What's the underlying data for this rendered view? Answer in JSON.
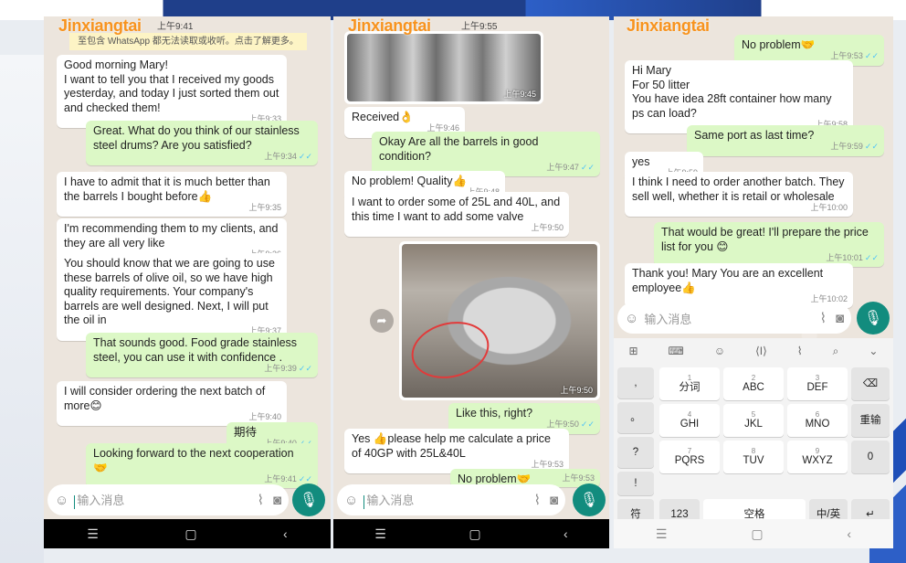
{
  "watermark": "Jinxiangtai",
  "phone1": {
    "status_time": "上午9:41",
    "notice": "至包含 WhatsApp 都无法读取或收听。点击了解更多。",
    "messages": [
      {
        "text": "Good morning  Mary!\nI want to tell you that I received my goods yesterday, and today I just sorted them out and checked them!",
        "time": "上午9:33",
        "dir": "in"
      },
      {
        "text": "Great. What do you think of our stainless steel drums? Are you satisfied?",
        "time": "上午9:34",
        "dir": "out"
      },
      {
        "text": "I have to admit that it is much better than the barrels I bought before👍",
        "time": "上午9:35",
        "dir": "in"
      },
      {
        "text": "I'm recommending them to my clients, and they are all very like",
        "time": "上午9:36",
        "dir": "in"
      },
      {
        "text": "You should know that we are going to use these barrels of olive oil, so we have high quality requirements. Your company's barrels are well designed. Next, I will put the oil in",
        "time": "上午9:37",
        "dir": "in"
      },
      {
        "text": "That sounds good. Food grade stainless steel, you can use it with confidence .",
        "time": "上午9:39",
        "dir": "out"
      },
      {
        "text": "I will consider ordering the next batch of more😊",
        "time": "上午9:40",
        "dir": "in"
      },
      {
        "text": "期待",
        "time": "上午9:40",
        "dir": "out"
      },
      {
        "text": "Looking forward to the next cooperation 🤝",
        "time": "上午9:41",
        "dir": "out"
      }
    ],
    "input_placeholder": "输入消息"
  },
  "phone2": {
    "status_time": "上午9:55",
    "photo1_time": "上午9:45",
    "messages": [
      {
        "text": "Received👌",
        "time": "上午9:46",
        "dir": "in"
      },
      {
        "text": "Okay  Are all the barrels in good condition?",
        "time": "上午9:47",
        "dir": "out"
      },
      {
        "text": "No problem! Quality👍",
        "time": "上午9:48",
        "dir": "in"
      },
      {
        "text": "I want to order some of 25L and 40L, and this time I want to add some valve",
        "time": "上午9:50",
        "dir": "in"
      },
      {
        "text": "Like this, right?",
        "time": "上午9:50",
        "dir": "out"
      },
      {
        "text": "Yes 👍please help me calculate a price of 40GP  with 25L&40L",
        "time": "上午9:53",
        "dir": "in"
      },
      {
        "text": "No problem🤝",
        "time": "上午9:53",
        "dir": "out"
      }
    ],
    "photo2_time": "上午9:50",
    "input_placeholder": "输入消息"
  },
  "phone3": {
    "messages": [
      {
        "text": "No problem🤝",
        "time": "上午9:53",
        "dir": "out"
      },
      {
        "text": "Hi Mary\nFor 50 litter\nYou have idea 28ft container how many ps can load?",
        "time": "上午9:58",
        "dir": "in"
      },
      {
        "text": "Same port as last time?",
        "time": "上午9:59",
        "dir": "out"
      },
      {
        "text": "yes",
        "time": "上午9:59",
        "dir": "in"
      },
      {
        "text": "I think I need to order another batch. They sell well, whether it is retail or wholesale",
        "time": "上午10:00",
        "dir": "in"
      },
      {
        "text": "That would be great! I'll prepare the price list for you 😊",
        "time": "上午10:01",
        "dir": "out"
      },
      {
        "text": "Thank you! Mary  You are an excellent employee👍",
        "time": "上午10:02",
        "dir": "in"
      }
    ],
    "input_placeholder": "输入消息",
    "keyboard": {
      "keys": [
        {
          "num": "1",
          "lbl": "分词"
        },
        {
          "num": "2",
          "lbl": "ABC"
        },
        {
          "num": "3",
          "lbl": "DEF"
        },
        {
          "num": "4",
          "lbl": "GHI"
        },
        {
          "num": "5",
          "lbl": "JKL"
        },
        {
          "num": "6",
          "lbl": "MNO"
        },
        {
          "num": "7",
          "lbl": "PQRS"
        },
        {
          "num": "8",
          "lbl": "TUV"
        },
        {
          "num": "9",
          "lbl": "WXYZ"
        }
      ],
      "left_keys": [
        ",",
        "。",
        "?",
        "!"
      ],
      "delete_label": "⌫",
      "reenter_label": "重输",
      "zero_label": "0",
      "symbol_label": "符",
      "num_label": "123",
      "space_label": "空格",
      "lang_label": "中/英",
      "enter_label": "↵"
    }
  }
}
